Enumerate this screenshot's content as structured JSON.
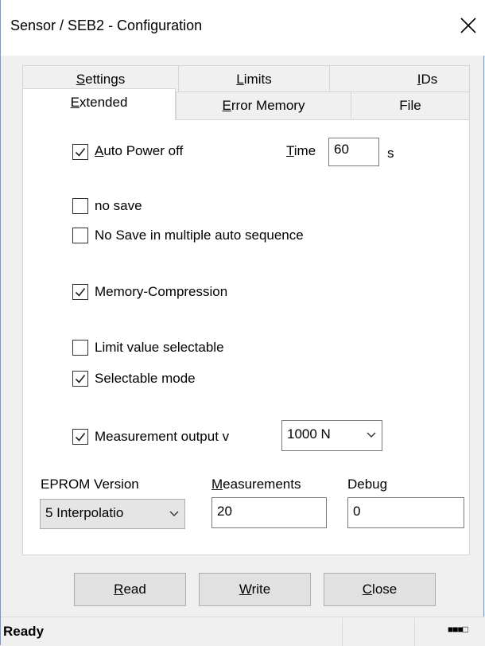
{
  "window": {
    "title": "Sensor / SEB2 - Configuration"
  },
  "tabs": {
    "row1": [
      {
        "pre": "",
        "u": "S",
        "post": "ettings"
      },
      {
        "pre": "",
        "u": "L",
        "post": "imits"
      },
      {
        "pre": "",
        "u": "I",
        "post": "Ds"
      }
    ],
    "row2": [
      {
        "pre": "",
        "u": "E",
        "post": "xtended",
        "active": true
      },
      {
        "pre": "",
        "u": "E",
        "post": "rror Memory"
      },
      {
        "pre": "File",
        "u": "",
        "post": ""
      }
    ]
  },
  "extended": {
    "auto_power": {
      "pre": "",
      "u": "A",
      "post": "uto Power off",
      "checked": true
    },
    "time_label": {
      "pre": "",
      "u": "T",
      "post": "ime"
    },
    "time_value": "60",
    "time_unit": "s",
    "no_save": {
      "label": "no save",
      "checked": false
    },
    "no_save_multi": {
      "label": "No Save in multiple auto sequence",
      "checked": false
    },
    "memory_compression": {
      "label": "Memory-Compression",
      "checked": true
    },
    "limit_selectable": {
      "label": "Limit value selectable",
      "checked": false
    },
    "selectable_mode": {
      "label": "Selectable mode",
      "checked": true
    },
    "measurement_output": {
      "label": "Measurement output v",
      "checked": true
    },
    "measurement_output_value": "1000 N",
    "eprom_label": "EPROM Version",
    "eprom_value": "5 Interpolatio",
    "measurements_label": {
      "pre": "",
      "u": "M",
      "post": "easurements"
    },
    "measurements_value": "20",
    "debug_label": "Debug",
    "debug_value": "0"
  },
  "buttons": {
    "read": {
      "pre": "",
      "u": "R",
      "post": "ead"
    },
    "write": {
      "pre": "",
      "u": "W",
      "post": "rite"
    },
    "close": {
      "pre": "",
      "u": "C",
      "post": "lose"
    }
  },
  "status": {
    "text": "Ready",
    "indicator": "■■■□"
  }
}
